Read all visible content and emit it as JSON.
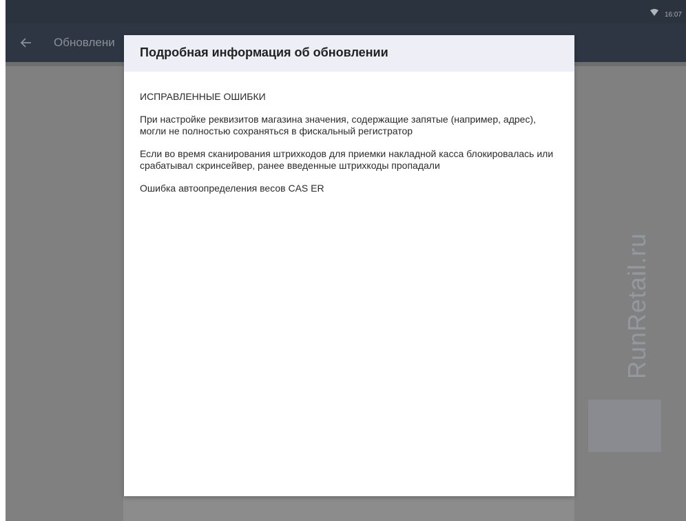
{
  "status_bar": {
    "time": "16:07",
    "wifi_icon": "wifi-icon"
  },
  "app_bar": {
    "back_icon": "arrow-back-icon",
    "title": "Обновлени"
  },
  "dialog": {
    "title": "Подробная информация об обновлении",
    "section_heading": "ИСПРАВЛЕННЫЕ ОШИБКИ",
    "items": [
      "При настройке реквизитов магазина значения, содержащие запятые (например, адрес), могли не полностью сохраняться в фискальный регистратор",
      "Если во время сканирования штрихкодов для приемки накладной касса блокировалась или срабатывал скринсейвер, ранее введенные штрихкоды пропадали",
      "Ошибка автоопределения весов CAS ER"
    ]
  },
  "watermark": {
    "text": "RunRetail.ru"
  },
  "colors": {
    "status_bar": "#2b333f",
    "app_bar": "#2e3643",
    "scrim": "#808080",
    "dialog_header": "#edeef6"
  }
}
